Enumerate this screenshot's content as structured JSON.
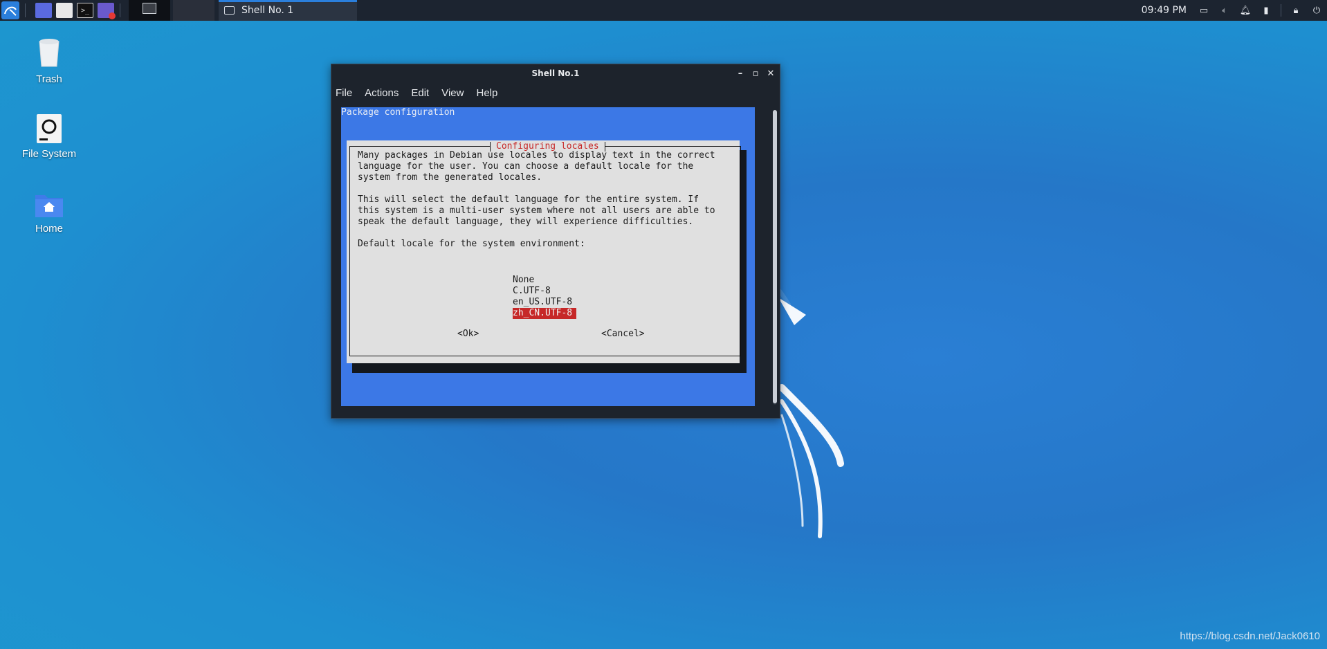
{
  "taskbar": {
    "task_title": "Shell No. 1",
    "clock": "09:49 PM",
    "launchers": [
      "kali-menu-icon",
      "workspace-icon",
      "file-manager-icon",
      "terminal-icon",
      "screen-recorder-icon"
    ]
  },
  "desktop": {
    "icons": [
      {
        "label": "Trash",
        "icon": "trash-icon"
      },
      {
        "label": "File System",
        "icon": "drive-icon"
      },
      {
        "label": "Home",
        "icon": "home-folder-icon"
      }
    ]
  },
  "window": {
    "title": "Shell No.1",
    "menu": [
      "File",
      "Actions",
      "Edit",
      "View",
      "Help"
    ]
  },
  "terminal": {
    "header": "Package configuration",
    "dialog": {
      "title": "Configuring locales",
      "paragraph1": "Many packages in Debian use locales to display text in the correct\nlanguage for the user. You can choose a default locale for the\nsystem from the generated locales.",
      "paragraph2": "This will select the default language for the entire system. If\nthis system is a multi-user system where not all users are able to\nspeak the default language, they will experience difficulties.",
      "prompt": "Default locale for the system environment:",
      "options": [
        "None",
        "C.UTF-8",
        "en_US.UTF-8",
        "zh_CN.UTF-8"
      ],
      "selected": "zh_CN.UTF-8",
      "ok_label": "<Ok>",
      "cancel_label": "<Cancel>"
    }
  },
  "watermark": "https://blog.csdn.net/Jack0610",
  "colors": {
    "desktop": "#2577c8",
    "taskbar": "#1c2430",
    "terminal_bg": "#3c78e6",
    "dialog_bg": "#e0e0e0",
    "accent_red": "#c62828"
  }
}
